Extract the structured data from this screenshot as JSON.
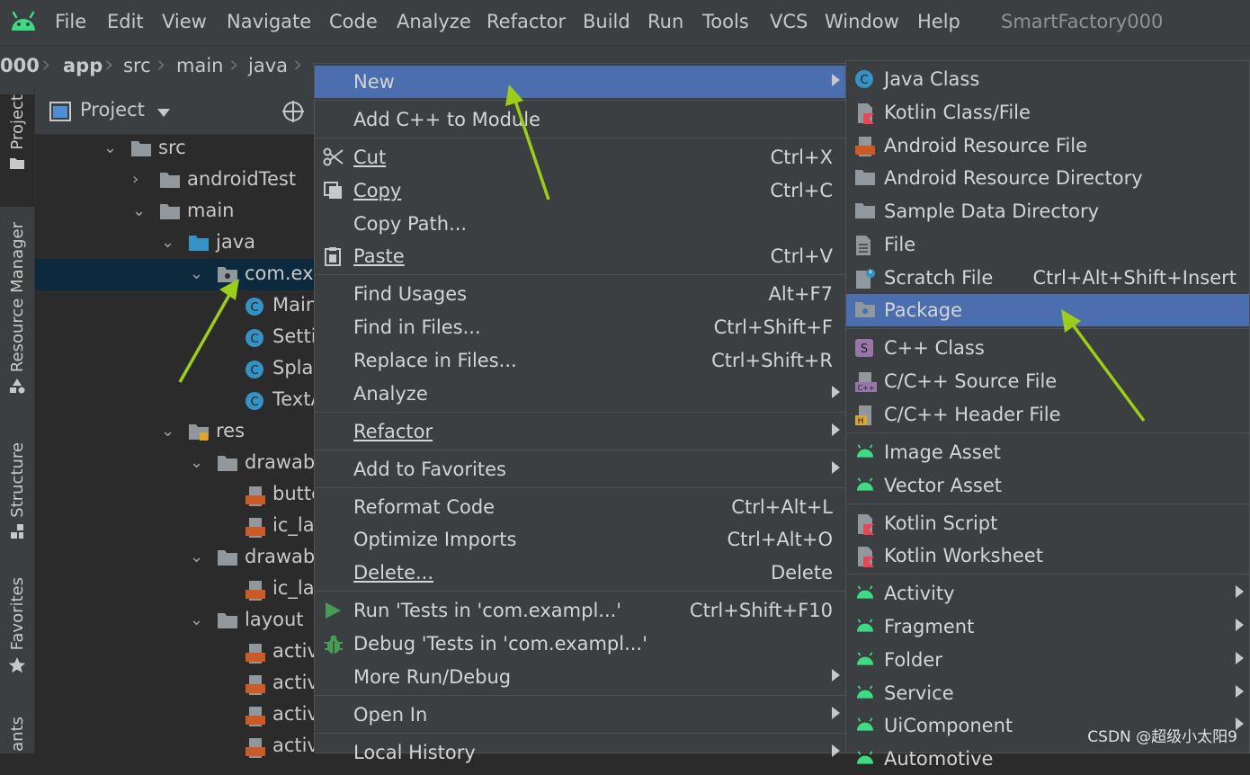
{
  "menubar": {
    "items": [
      "File",
      "Edit",
      "View",
      "Navigate",
      "Code",
      "Analyze",
      "Refactor",
      "Build",
      "Run",
      "Tools",
      "VCS",
      "Window",
      "Help"
    ],
    "project_title": "SmartFactory000"
  },
  "navbar": {
    "crumbs": [
      "000",
      "app",
      "src",
      "main",
      "java"
    ]
  },
  "stripe": {
    "tabs": [
      "Project",
      "Resource Manager",
      "Structure",
      "Favorites",
      "ants"
    ]
  },
  "project_panel": {
    "title": "Project",
    "tree": [
      {
        "label": "src"
      },
      {
        "label": "androidTest"
      },
      {
        "label": "main"
      },
      {
        "label": "java"
      },
      {
        "label": "com.exa"
      },
      {
        "label": "Main"
      },
      {
        "label": "Setti"
      },
      {
        "label": "Splas"
      },
      {
        "label": "TextA"
      },
      {
        "label": "res"
      },
      {
        "label": "drawab"
      },
      {
        "label": "butto"
      },
      {
        "label": "ic_la"
      },
      {
        "label": "drawab"
      },
      {
        "label": "ic_la"
      },
      {
        "label": "layout"
      },
      {
        "label": "activ"
      },
      {
        "label": "activ"
      },
      {
        "label": "activ"
      },
      {
        "label": "activ"
      }
    ]
  },
  "context_menu": {
    "items": [
      {
        "label": "New"
      },
      {
        "label": "Add C++ to Module"
      },
      {
        "label": "Cut",
        "shortcut": "Ctrl+X"
      },
      {
        "label": "Copy",
        "shortcut": "Ctrl+C"
      },
      {
        "label": "Copy Path..."
      },
      {
        "label": "Paste",
        "shortcut": "Ctrl+V"
      },
      {
        "label": "Find Usages",
        "shortcut": "Alt+F7"
      },
      {
        "label": "Find in Files...",
        "shortcut": "Ctrl+Shift+F"
      },
      {
        "label": "Replace in Files...",
        "shortcut": "Ctrl+Shift+R"
      },
      {
        "label": "Analyze"
      },
      {
        "label": "Refactor"
      },
      {
        "label": "Add to Favorites"
      },
      {
        "label": "Reformat Code",
        "shortcut": "Ctrl+Alt+L"
      },
      {
        "label": "Optimize Imports",
        "shortcut": "Ctrl+Alt+O"
      },
      {
        "label": "Delete...",
        "shortcut": "Delete"
      },
      {
        "label": "Run 'Tests in 'com.exampl...'",
        "shortcut": "Ctrl+Shift+F10"
      },
      {
        "label": "Debug 'Tests in 'com.exampl...'"
      },
      {
        "label": "More Run/Debug"
      },
      {
        "label": "Open In"
      },
      {
        "label": "Local History"
      }
    ]
  },
  "new_submenu": {
    "items": [
      {
        "label": "Java Class"
      },
      {
        "label": "Kotlin Class/File"
      },
      {
        "label": "Android Resource File"
      },
      {
        "label": "Android Resource Directory"
      },
      {
        "label": "Sample Data Directory"
      },
      {
        "label": "File"
      },
      {
        "label": "Scratch File",
        "shortcut": "Ctrl+Alt+Shift+Insert"
      },
      {
        "label": "Package"
      },
      {
        "label": "C++ Class"
      },
      {
        "label": "C/C++ Source File"
      },
      {
        "label": "C/C++ Header File"
      },
      {
        "label": "Image Asset"
      },
      {
        "label": "Vector Asset"
      },
      {
        "label": "Kotlin Script"
      },
      {
        "label": "Kotlin Worksheet"
      },
      {
        "label": "Activity"
      },
      {
        "label": "Fragment"
      },
      {
        "label": "Folder"
      },
      {
        "label": "Service"
      },
      {
        "label": "UiComponent"
      },
      {
        "label": "Automotive"
      }
    ]
  },
  "colors": {
    "highlight": "#4b6eaf",
    "tree_selection": "#0d293e",
    "annotation_arrow": "#9ccd1a",
    "android_green": "#3ddc84"
  },
  "watermark": "CSDN @超级小太阳9"
}
